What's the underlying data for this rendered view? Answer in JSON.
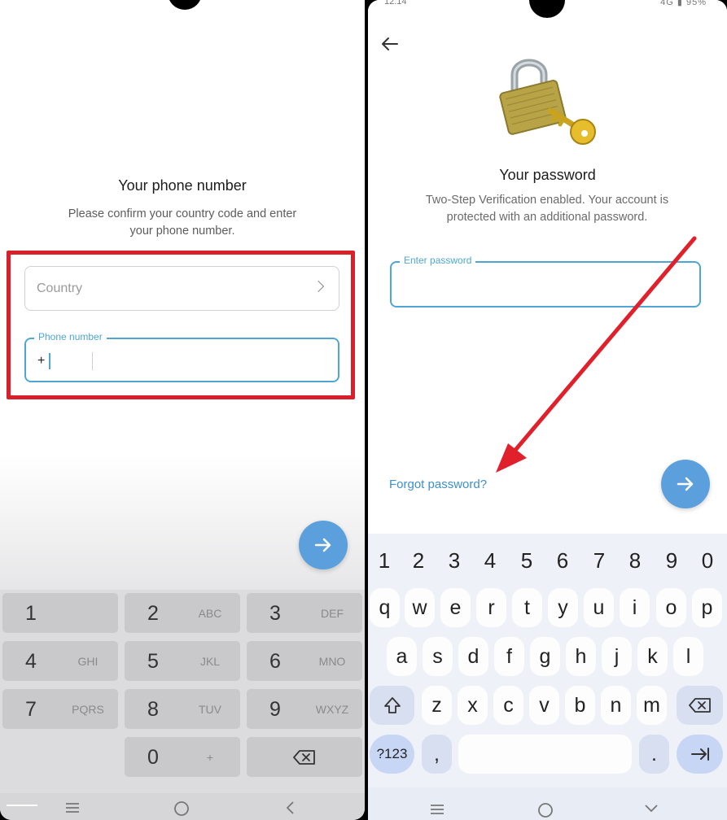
{
  "left": {
    "title": "Your phone number",
    "subtitle": "Please confirm your country code and enter your phone number.",
    "country_field": {
      "placeholder": "Country",
      "chevron_icon": "chevron-right-icon"
    },
    "phone_field": {
      "label": "Phone number",
      "prefix": "+"
    },
    "next_button_icon": "arrow-right-icon",
    "numpad": [
      {
        "digit": "1",
        "letters": ""
      },
      {
        "digit": "2",
        "letters": "ABC"
      },
      {
        "digit": "3",
        "letters": "DEF"
      },
      {
        "digit": "4",
        "letters": "GHI"
      },
      {
        "digit": "5",
        "letters": "JKL"
      },
      {
        "digit": "6",
        "letters": "MNO"
      },
      {
        "digit": "7",
        "letters": "PQRS"
      },
      {
        "digit": "8",
        "letters": "TUV"
      },
      {
        "digit": "9",
        "letters": "WXYZ"
      },
      {
        "digit": "0",
        "letters": "+"
      }
    ],
    "navbar": [
      "menu-icon",
      "home-icon",
      "back-icon"
    ],
    "highlight_color": "#d9202a"
  },
  "right": {
    "status": {
      "time": "12:14",
      "battery": "95%",
      "network": "4G"
    },
    "back_icon": "arrow-left-icon",
    "illustration": "padlock-key-icon",
    "title": "Your password",
    "subtitle": "Two-Step Verification enabled. Your account is protected with an additional password.",
    "password_field": {
      "label": "Enter password",
      "value": ""
    },
    "forgot_link": "Forgot password?",
    "next_button_icon": "arrow-right-icon",
    "keyboard": {
      "numbers": [
        "1",
        "2",
        "3",
        "4",
        "5",
        "6",
        "7",
        "8",
        "9",
        "0"
      ],
      "row1": [
        "q",
        "w",
        "e",
        "r",
        "t",
        "y",
        "u",
        "i",
        "o",
        "p"
      ],
      "row2": [
        "a",
        "s",
        "d",
        "f",
        "g",
        "h",
        "j",
        "k",
        "l"
      ],
      "row3": [
        "z",
        "x",
        "c",
        "v",
        "b",
        "n",
        "m"
      ],
      "symbols_key": "?123",
      "comma_key": ",",
      "period_key": ".",
      "shift_icon": "shift-icon",
      "backspace_icon": "backspace-icon",
      "enter_icon": "tab-arrow-icon"
    },
    "navbar": [
      "menu-icon",
      "home-icon",
      "chevron-down-icon"
    ],
    "accent_color": "#4fa6d3",
    "annotation_color": "#e0202a"
  }
}
